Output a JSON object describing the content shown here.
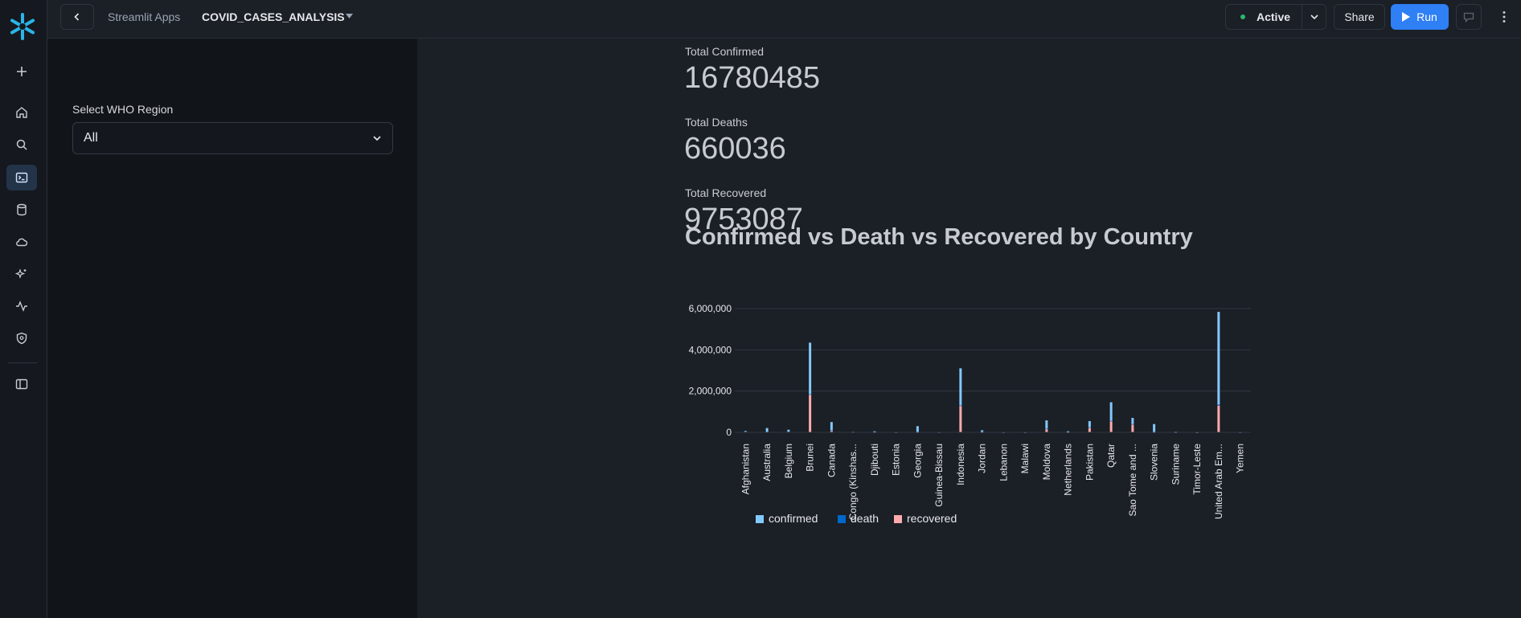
{
  "colors": {
    "accent": "#2f7ff5",
    "confirmed": "#83c9ff",
    "death": "#0068c9",
    "recovered": "#ffabab",
    "status_active": "#2bb673"
  },
  "rail": {
    "icons": [
      "snowflake-logo-icon",
      "plus-icon",
      "home-icon",
      "search-icon",
      "terminal-icon",
      "database-icon",
      "cloud-icon",
      "sparkle-icon",
      "activity-icon",
      "shield-icon",
      "sidebar-toggle-icon"
    ]
  },
  "topbar": {
    "breadcrumb": "Streamlit Apps",
    "app_name": "COVID_CASES_ANALYSIS",
    "status": "Active",
    "share_label": "Share",
    "run_label": "Run"
  },
  "sidebar": {
    "select_label": "Select WHO Region",
    "select_value": "All"
  },
  "metrics": [
    {
      "label": "Total Confirmed",
      "value": "16780485"
    },
    {
      "label": "Total Deaths",
      "value": "660036"
    },
    {
      "label": "Total Recovered",
      "value": "9753087"
    }
  ],
  "chart_data": {
    "type": "bar",
    "stacked": true,
    "title": "Confirmed vs Death vs Recovered by Country",
    "ylim": [
      0,
      6000000
    ],
    "yticks": [
      "6,000,000",
      "4,000,000",
      "2,000,000",
      "0"
    ],
    "ytick_values": [
      6000000,
      4000000,
      2000000,
      0
    ],
    "grid": true,
    "legend_position": "bottom",
    "categories": [
      "Afghanistan",
      "Australia",
      "Belgium",
      "Brunei",
      "Canada",
      "Congo (Kinshas...",
      "Djibouti",
      "Estonia",
      "Georgia",
      "Guinea-Bissau",
      "Indonesia",
      "Jordan",
      "Lebanon",
      "Malawi",
      "Moldova",
      "Netherlands",
      "Pakistan",
      "Qatar",
      "Sao Tome and ...",
      "Slovenia",
      "Suriname",
      "Timor-Leste",
      "United Arab Em...",
      "Yemen"
    ],
    "series": [
      {
        "name": "confirmed",
        "values": [
          40000,
          200000,
          100000,
          2500000,
          400000,
          20000,
          50000,
          20000,
          300000,
          10000,
          1800000,
          100000,
          20000,
          5000,
          400000,
          50000,
          300000,
          900000,
          300000,
          400000,
          30000,
          5000,
          4500000,
          10000
        ]
      },
      {
        "name": "death",
        "values": [
          1300,
          170,
          9800,
          3,
          8900,
          150,
          58,
          69,
          16,
          26,
          4800,
          11,
          51,
          99,
          748,
          6160,
          5900,
          165,
          14,
          116,
          24,
          0,
          45000,
          483
        ]
      },
      {
        "name": "recovered",
        "values": [
          26000,
          10000,
          17000,
          1850000,
          90000,
          8000,
          4800,
          1900,
          1700,
          900,
          1300000,
          1100,
          1900,
          1600,
          180000,
          189,
          240000,
          560000,
          400000,
          1900,
          1200,
          24,
          1300000,
          830
        ]
      }
    ]
  }
}
